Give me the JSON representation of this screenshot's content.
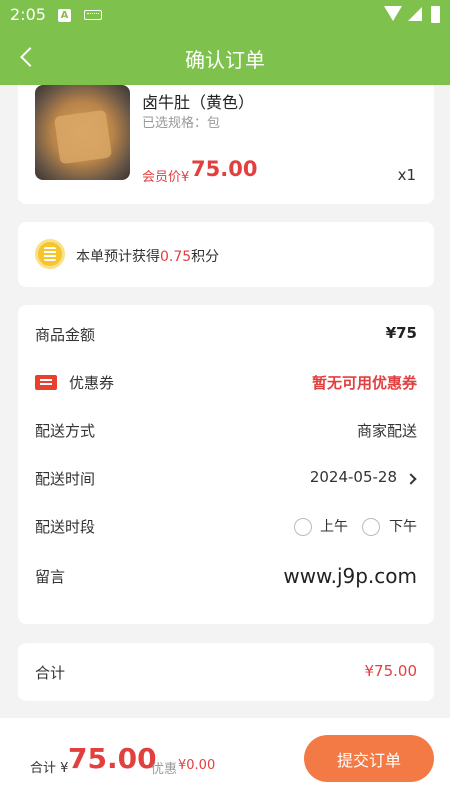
{
  "status_bar": {
    "time": "2:05",
    "a_badge": "A"
  },
  "header": {
    "title": "确认订单"
  },
  "product": {
    "name": "卤牛肚（黄色）",
    "spec": "已选规格：包",
    "price_label": "会员价¥",
    "price": "75.00",
    "quantity": "x1"
  },
  "points": {
    "prefix": "本单预计获得",
    "value": "0.75",
    "suffix": "积分"
  },
  "details": {
    "goods_amount_label": "商品金额",
    "goods_amount": "¥75",
    "coupon_label": "优惠券",
    "coupon_value": "暂无可用优惠券",
    "delivery_method_label": "配送方式",
    "delivery_method": "商家配送",
    "delivery_time_label": "配送时间",
    "delivery_time": "2024-05-28",
    "delivery_slot_label": "配送时段",
    "slot_am": "上午",
    "slot_pm": "下午",
    "note_label": "留言",
    "note_value": "www.j9p.com"
  },
  "total": {
    "label": "合计",
    "value": "¥75.00"
  },
  "bottom": {
    "sum_label": "合计 ¥",
    "sum_value": "75.00",
    "discount_label": "优惠",
    "discount_value": "¥0.00",
    "submit_label": "提交订单"
  },
  "colors": {
    "header_green": "#7ec24d",
    "price_red": "#e23f3f",
    "submit_orange": "#f47a45"
  }
}
